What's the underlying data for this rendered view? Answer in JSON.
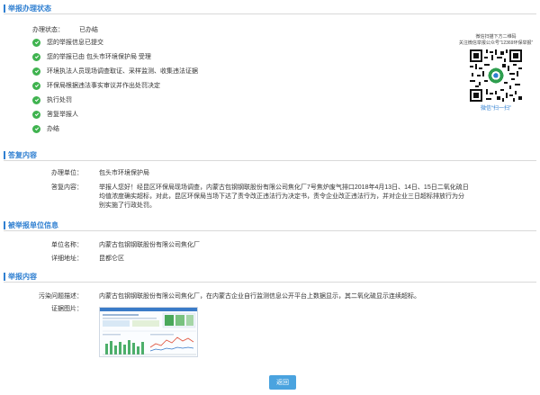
{
  "sections": {
    "status": "举报办理状态",
    "reply": "答复内容",
    "reported": "被举报单位信息",
    "report": "举报内容"
  },
  "status": {
    "label": "办理状态：",
    "value": "已办结",
    "steps": [
      "您的举报信息已提交",
      "您的举报已由 包头市环境保护局 受理",
      "环境执法人员现场调查取证、采样监测、收集违法证据",
      "环保局根据违法事实审议并作出处罚决定",
      "执行处罚",
      "答复举报人",
      "办结"
    ]
  },
  "qr": {
    "caption_line1": "微信扫描下方二维码",
    "caption_line2": "关注微信举报公众号“12369环保举报”",
    "scan_text": "微信“扫一扫”"
  },
  "reply": {
    "unit_label": "办理单位：",
    "unit_value": "包头市环境保护局",
    "content_label": "答复内容：",
    "content_value": "举报人您好！经昆区环保局现场调查，内蒙古包钢钢联股份有限公司焦化厂7号焦炉废气排口2018年4月13日、14日、15日二氧化硫日均值浓度确实超标，对此，昆区环保局当场下达了责令改正违法行为决定书，责令企业改正违法行为，并对企业三日超标排放行为分别实施了行政处罚。"
  },
  "reported": {
    "name_label": "单位名称：",
    "name_value": "内蒙古包钢钢联股份有限公司焦化厂",
    "addr_label": "详细地址：",
    "addr_value": "昆都仑区"
  },
  "report": {
    "problem_label": "污染问题描述：",
    "problem_value": "内蒙古包钢钢联股份有限公司焦化厂，在内蒙古企业自行监测信息公开平台上数据显示，其二氧化硫显示连续超标。",
    "image_label": "证据图片："
  },
  "actions": {
    "back": "返回"
  },
  "colors": {
    "accent": "#2f7fd1",
    "check": "#3fb34f",
    "button": "#4aa3df"
  }
}
